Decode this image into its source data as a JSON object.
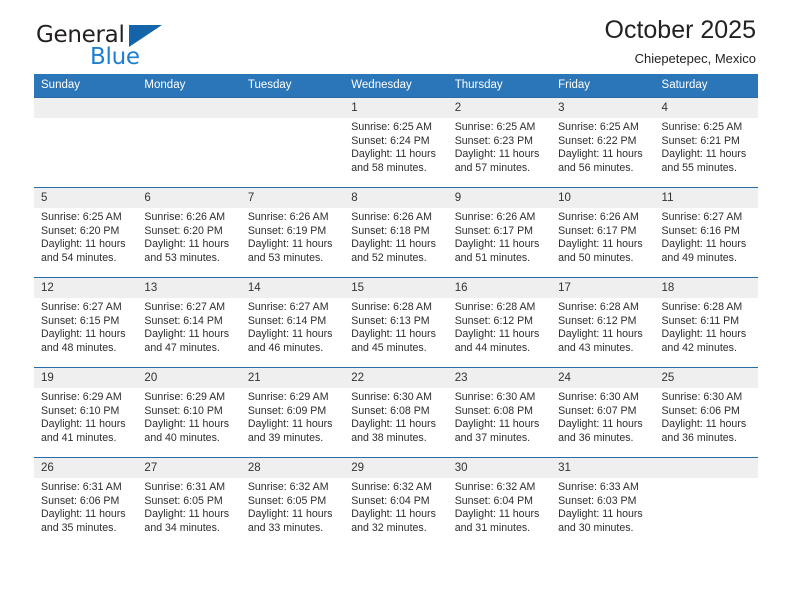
{
  "brand": {
    "name_primary": "General",
    "name_secondary": "Blue",
    "flag_icon": "triangle-flag-icon"
  },
  "header": {
    "title": "October 2025",
    "subtitle": "Chiepetepec, Mexico"
  },
  "colors": {
    "header_blue": "#2b76b9",
    "row_border_blue": "#2b6ca8",
    "daynum_band": "#efefef",
    "brand_blue": "#1c7fd4",
    "brand_flag": "#1464aa"
  },
  "weekdays": [
    "Sunday",
    "Monday",
    "Tuesday",
    "Wednesday",
    "Thursday",
    "Friday",
    "Saturday"
  ],
  "weeks": [
    [
      {
        "day": "",
        "sunrise": "",
        "sunset": "",
        "daylight": ""
      },
      {
        "day": "",
        "sunrise": "",
        "sunset": "",
        "daylight": ""
      },
      {
        "day": "",
        "sunrise": "",
        "sunset": "",
        "daylight": ""
      },
      {
        "day": "1",
        "sunrise": "Sunrise: 6:25 AM",
        "sunset": "Sunset: 6:24 PM",
        "daylight": "Daylight: 11 hours and 58 minutes."
      },
      {
        "day": "2",
        "sunrise": "Sunrise: 6:25 AM",
        "sunset": "Sunset: 6:23 PM",
        "daylight": "Daylight: 11 hours and 57 minutes."
      },
      {
        "day": "3",
        "sunrise": "Sunrise: 6:25 AM",
        "sunset": "Sunset: 6:22 PM",
        "daylight": "Daylight: 11 hours and 56 minutes."
      },
      {
        "day": "4",
        "sunrise": "Sunrise: 6:25 AM",
        "sunset": "Sunset: 6:21 PM",
        "daylight": "Daylight: 11 hours and 55 minutes."
      }
    ],
    [
      {
        "day": "5",
        "sunrise": "Sunrise: 6:25 AM",
        "sunset": "Sunset: 6:20 PM",
        "daylight": "Daylight: 11 hours and 54 minutes."
      },
      {
        "day": "6",
        "sunrise": "Sunrise: 6:26 AM",
        "sunset": "Sunset: 6:20 PM",
        "daylight": "Daylight: 11 hours and 53 minutes."
      },
      {
        "day": "7",
        "sunrise": "Sunrise: 6:26 AM",
        "sunset": "Sunset: 6:19 PM",
        "daylight": "Daylight: 11 hours and 53 minutes."
      },
      {
        "day": "8",
        "sunrise": "Sunrise: 6:26 AM",
        "sunset": "Sunset: 6:18 PM",
        "daylight": "Daylight: 11 hours and 52 minutes."
      },
      {
        "day": "9",
        "sunrise": "Sunrise: 6:26 AM",
        "sunset": "Sunset: 6:17 PM",
        "daylight": "Daylight: 11 hours and 51 minutes."
      },
      {
        "day": "10",
        "sunrise": "Sunrise: 6:26 AM",
        "sunset": "Sunset: 6:17 PM",
        "daylight": "Daylight: 11 hours and 50 minutes."
      },
      {
        "day": "11",
        "sunrise": "Sunrise: 6:27 AM",
        "sunset": "Sunset: 6:16 PM",
        "daylight": "Daylight: 11 hours and 49 minutes."
      }
    ],
    [
      {
        "day": "12",
        "sunrise": "Sunrise: 6:27 AM",
        "sunset": "Sunset: 6:15 PM",
        "daylight": "Daylight: 11 hours and 48 minutes."
      },
      {
        "day": "13",
        "sunrise": "Sunrise: 6:27 AM",
        "sunset": "Sunset: 6:14 PM",
        "daylight": "Daylight: 11 hours and 47 minutes."
      },
      {
        "day": "14",
        "sunrise": "Sunrise: 6:27 AM",
        "sunset": "Sunset: 6:14 PM",
        "daylight": "Daylight: 11 hours and 46 minutes."
      },
      {
        "day": "15",
        "sunrise": "Sunrise: 6:28 AM",
        "sunset": "Sunset: 6:13 PM",
        "daylight": "Daylight: 11 hours and 45 minutes."
      },
      {
        "day": "16",
        "sunrise": "Sunrise: 6:28 AM",
        "sunset": "Sunset: 6:12 PM",
        "daylight": "Daylight: 11 hours and 44 minutes."
      },
      {
        "day": "17",
        "sunrise": "Sunrise: 6:28 AM",
        "sunset": "Sunset: 6:12 PM",
        "daylight": "Daylight: 11 hours and 43 minutes."
      },
      {
        "day": "18",
        "sunrise": "Sunrise: 6:28 AM",
        "sunset": "Sunset: 6:11 PM",
        "daylight": "Daylight: 11 hours and 42 minutes."
      }
    ],
    [
      {
        "day": "19",
        "sunrise": "Sunrise: 6:29 AM",
        "sunset": "Sunset: 6:10 PM",
        "daylight": "Daylight: 11 hours and 41 minutes."
      },
      {
        "day": "20",
        "sunrise": "Sunrise: 6:29 AM",
        "sunset": "Sunset: 6:10 PM",
        "daylight": "Daylight: 11 hours and 40 minutes."
      },
      {
        "day": "21",
        "sunrise": "Sunrise: 6:29 AM",
        "sunset": "Sunset: 6:09 PM",
        "daylight": "Daylight: 11 hours and 39 minutes."
      },
      {
        "day": "22",
        "sunrise": "Sunrise: 6:30 AM",
        "sunset": "Sunset: 6:08 PM",
        "daylight": "Daylight: 11 hours and 38 minutes."
      },
      {
        "day": "23",
        "sunrise": "Sunrise: 6:30 AM",
        "sunset": "Sunset: 6:08 PM",
        "daylight": "Daylight: 11 hours and 37 minutes."
      },
      {
        "day": "24",
        "sunrise": "Sunrise: 6:30 AM",
        "sunset": "Sunset: 6:07 PM",
        "daylight": "Daylight: 11 hours and 36 minutes."
      },
      {
        "day": "25",
        "sunrise": "Sunrise: 6:30 AM",
        "sunset": "Sunset: 6:06 PM",
        "daylight": "Daylight: 11 hours and 36 minutes."
      }
    ],
    [
      {
        "day": "26",
        "sunrise": "Sunrise: 6:31 AM",
        "sunset": "Sunset: 6:06 PM",
        "daylight": "Daylight: 11 hours and 35 minutes."
      },
      {
        "day": "27",
        "sunrise": "Sunrise: 6:31 AM",
        "sunset": "Sunset: 6:05 PM",
        "daylight": "Daylight: 11 hours and 34 minutes."
      },
      {
        "day": "28",
        "sunrise": "Sunrise: 6:32 AM",
        "sunset": "Sunset: 6:05 PM",
        "daylight": "Daylight: 11 hours and 33 minutes."
      },
      {
        "day": "29",
        "sunrise": "Sunrise: 6:32 AM",
        "sunset": "Sunset: 6:04 PM",
        "daylight": "Daylight: 11 hours and 32 minutes."
      },
      {
        "day": "30",
        "sunrise": "Sunrise: 6:32 AM",
        "sunset": "Sunset: 6:04 PM",
        "daylight": "Daylight: 11 hours and 31 minutes."
      },
      {
        "day": "31",
        "sunrise": "Sunrise: 6:33 AM",
        "sunset": "Sunset: 6:03 PM",
        "daylight": "Daylight: 11 hours and 30 minutes."
      },
      {
        "day": "",
        "sunrise": "",
        "sunset": "",
        "daylight": ""
      }
    ]
  ]
}
